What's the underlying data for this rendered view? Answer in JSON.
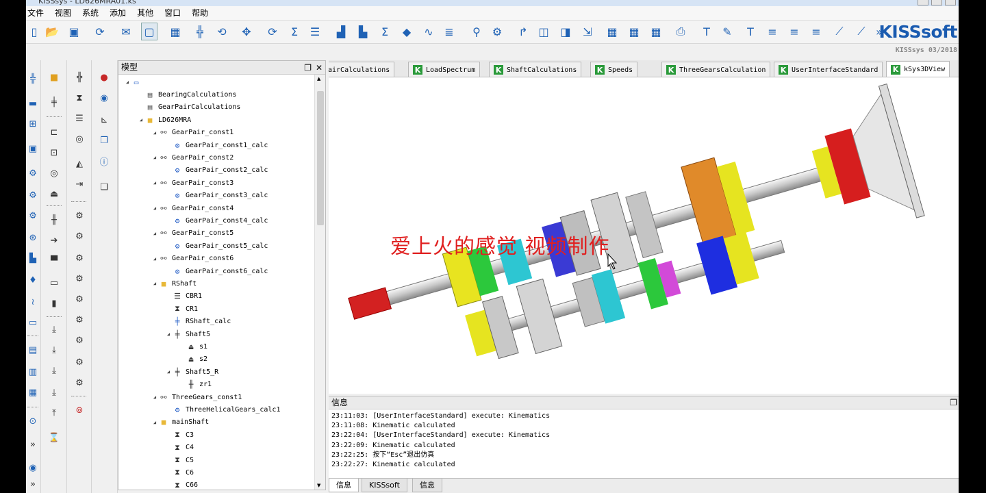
{
  "window": {
    "title": "KISSsys - LD626MRA01.ks"
  },
  "menu": [
    "文件",
    "视图",
    "系统",
    "添加",
    "其他",
    "窗口",
    "帮助"
  ],
  "brand": {
    "logo": "KISSsoft",
    "version": "KISSsys 03/2018"
  },
  "toolbar_icons": [
    "new-icon",
    "open-icon",
    "save-icon",
    "refresh-icon",
    "mail-icon",
    "window-icon",
    "calculator-icon",
    "split-icon",
    "sync-icon",
    "move-icon",
    "rotate-icon",
    "sum-icon",
    "report-icon",
    "chart-icon",
    "chart2-icon",
    "sigma-chart-icon",
    "color-icon",
    "curve-icon",
    "list-icon",
    "probe-icon",
    "config-icon",
    "arrow-icon",
    "cube-icon",
    "cube2-icon",
    "export-icon",
    "table-icon",
    "table2-icon",
    "table3-icon",
    "print-icon",
    "text-box-icon",
    "pen-icon",
    "text-icon",
    "align-left-icon",
    "align-center-icon",
    "align-right-icon",
    "graph-icon",
    "graph2-icon",
    "more-icon"
  ],
  "model_panel": {
    "title": "模型",
    "tree": [
      {
        "label": "",
        "level": 0,
        "icon": "window",
        "expanded": true
      },
      {
        "label": "BearingCalculations",
        "level": 1,
        "icon": "doc"
      },
      {
        "label": "GearPairCalculations",
        "level": 1,
        "icon": "doc"
      },
      {
        "label": "LD626MRA",
        "level": 1,
        "icon": "folder",
        "expanded": true
      },
      {
        "label": "GearPair_const1",
        "level": 2,
        "icon": "pair",
        "expanded": true
      },
      {
        "label": "GearPair_const1_calc",
        "level": 3,
        "icon": "gear"
      },
      {
        "label": "GearPair_const2",
        "level": 2,
        "icon": "pair",
        "expanded": true
      },
      {
        "label": "GearPair_const2_calc",
        "level": 3,
        "icon": "gear"
      },
      {
        "label": "GearPair_const3",
        "level": 2,
        "icon": "pair",
        "expanded": true
      },
      {
        "label": "GearPair_const3_calc",
        "level": 3,
        "icon": "gear"
      },
      {
        "label": "GearPair_const4",
        "level": 2,
        "icon": "pair",
        "expanded": true
      },
      {
        "label": "GearPair_const4_calc",
        "level": 3,
        "icon": "gear"
      },
      {
        "label": "GearPair_const5",
        "level": 2,
        "icon": "pair",
        "expanded": true
      },
      {
        "label": "GearPair_const5_calc",
        "level": 3,
        "icon": "gear"
      },
      {
        "label": "GearPair_const6",
        "level": 2,
        "icon": "pair",
        "expanded": true
      },
      {
        "label": "GearPair_const6_calc",
        "level": 3,
        "icon": "gear"
      },
      {
        "label": "RShaft",
        "level": 2,
        "icon": "folder",
        "expanded": true
      },
      {
        "label": "CBR1",
        "level": 3,
        "icon": "bearing"
      },
      {
        "label": "CR1",
        "level": 3,
        "icon": "hourglass"
      },
      {
        "label": "RShaft_calc",
        "level": 3,
        "icon": "shaft-calc"
      },
      {
        "label": "Shaft5",
        "level": 3,
        "icon": "shaft",
        "expanded": true
      },
      {
        "label": "s1",
        "level": 4,
        "icon": "support"
      },
      {
        "label": "s2",
        "level": 4,
        "icon": "support"
      },
      {
        "label": "Shaft5_R",
        "level": 3,
        "icon": "shaft",
        "expanded": true
      },
      {
        "label": "zr1",
        "level": 4,
        "icon": "gear-element"
      },
      {
        "label": "ThreeGears_const1",
        "level": 2,
        "icon": "three",
        "expanded": true
      },
      {
        "label": "ThreeHelicalGears_calc1",
        "level": 3,
        "icon": "gear"
      },
      {
        "label": "mainShaft",
        "level": 2,
        "icon": "folder",
        "expanded": true
      },
      {
        "label": "C3",
        "level": 3,
        "icon": "hourglass"
      },
      {
        "label": "C4",
        "level": 3,
        "icon": "hourglass"
      },
      {
        "label": "C5",
        "level": 3,
        "icon": "hourglass"
      },
      {
        "label": "C6",
        "level": 3,
        "icon": "hourglass"
      },
      {
        "label": "C66",
        "level": 3,
        "icon": "hourglass"
      }
    ]
  },
  "tabs": [
    {
      "label": "airCalculations",
      "k": false
    },
    {
      "label": "LoadSpectrum",
      "k": true
    },
    {
      "label": "ShaftCalculations",
      "k": true
    },
    {
      "label": "Speeds",
      "k": true
    },
    {
      "label": "ThreeGearsCalculation",
      "k": true
    },
    {
      "label": "UserInterfaceStandard",
      "k": true
    },
    {
      "label": "kSys3DView",
      "k": true,
      "active": true
    }
  ],
  "view3d": {
    "watermark": "爱上火的感觉 视频制作"
  },
  "info_panel": {
    "title": "信息",
    "log": [
      "23:11:03: [UserInterfaceStandard] execute: Kinematics",
      "23:11:08: Kinematic calculated",
      "23:22:04: [UserInterfaceStandard] execute: Kinematics",
      "23:22:09: Kinematic calculated",
      "23:22:25: 按下“Esc”退出仿真",
      "23:22:27: Kinematic calculated"
    ],
    "tabs": [
      "信息",
      "KISSsoft",
      "信息"
    ]
  },
  "colors": {
    "brand": "#1a5bb0",
    "k_icon": "#2a9a3a",
    "watermark": "#e02020"
  }
}
